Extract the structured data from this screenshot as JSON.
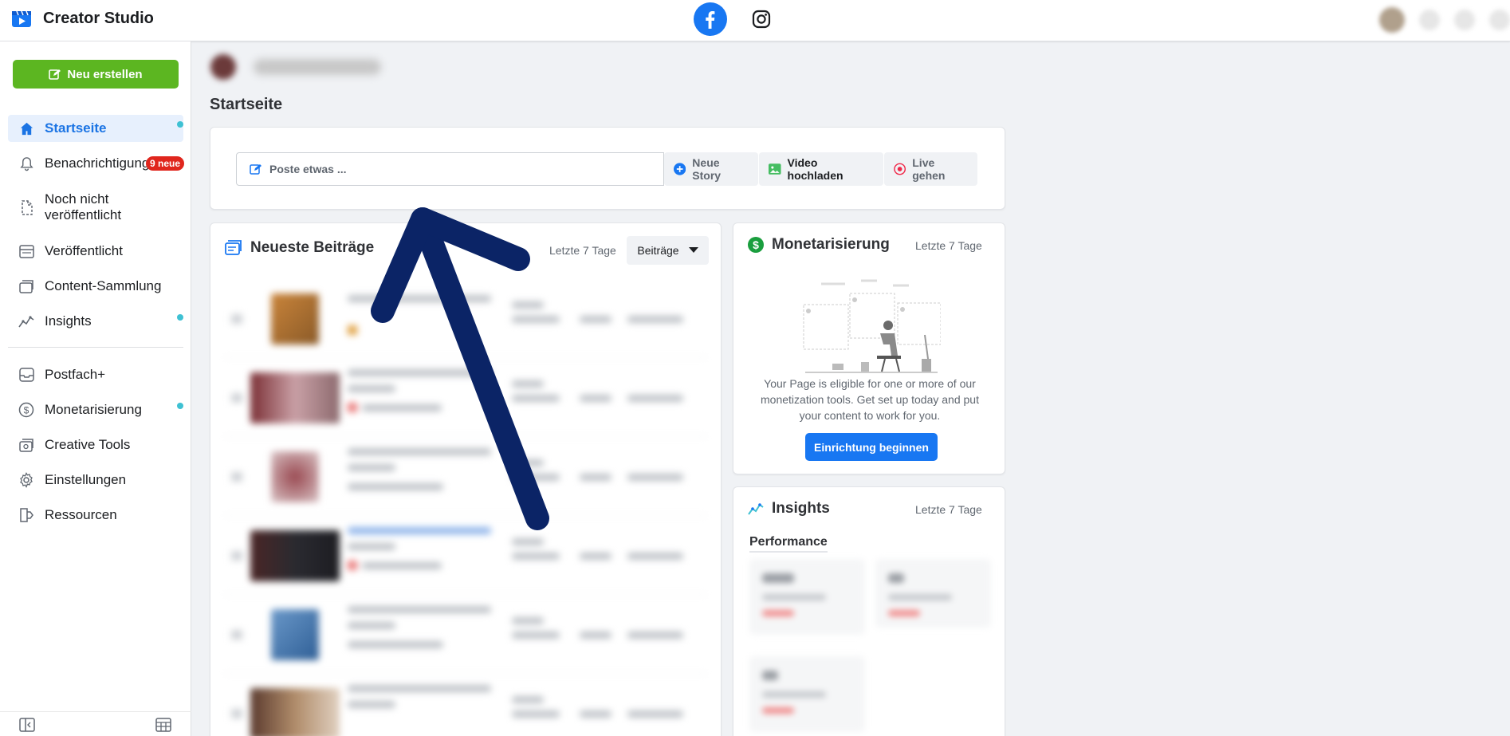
{
  "app": {
    "title": "Creator Studio",
    "platforms": [
      "facebook-icon",
      "instagram-icon"
    ]
  },
  "colors": {
    "accent": "#1877f2",
    "create_green": "#5cb621",
    "active_bg": "#e7f0fd",
    "badge_red": "#e0261d",
    "dot_teal": "#3ec1d3",
    "arrow": "#0b2466"
  },
  "sidebar": {
    "create_label": "Neu erstellen",
    "items": [
      {
        "label": "Startseite",
        "icon": "home-icon"
      },
      {
        "label": "Benachrichtigung",
        "icon": "bell-icon",
        "badge": "9 neue"
      },
      {
        "label": "Noch nicht veröffentlicht",
        "icon": "draft-icon"
      },
      {
        "label": "Veröffentlicht",
        "icon": "published-icon"
      },
      {
        "label": "Content-Sammlung",
        "icon": "library-icon"
      },
      {
        "label": "Insights",
        "icon": "insights-icon"
      },
      {
        "label": "Postfach+",
        "icon": "inbox-icon"
      },
      {
        "label": "Monetarisierung",
        "icon": "dollar-icon"
      },
      {
        "label": "Creative Tools",
        "icon": "creative-tools-icon"
      },
      {
        "label": "Einstellungen",
        "icon": "gear-icon"
      },
      {
        "label": "Ressourcen",
        "icon": "resources-icon"
      }
    ]
  },
  "page": {
    "title": "Startseite"
  },
  "composer": {
    "placeholder": "Poste etwas ...",
    "new_story": "Neue Story",
    "upload_video": "Video hochladen",
    "go_live": "Live gehen"
  },
  "recent_posts": {
    "title": "Neueste Beiträge",
    "range": "Letzte 7 Tage",
    "filter": "Beiträge"
  },
  "monetization": {
    "title": "Monetarisierung",
    "range": "Letzte 7 Tage",
    "description": "Your Page is eligible for one or more of our monetization tools. Get set up today and put your content to work for you.",
    "button": "Einrichtung beginnen"
  },
  "insights": {
    "title": "Insights",
    "range": "Letzte 7 Tage",
    "section": "Performance"
  }
}
